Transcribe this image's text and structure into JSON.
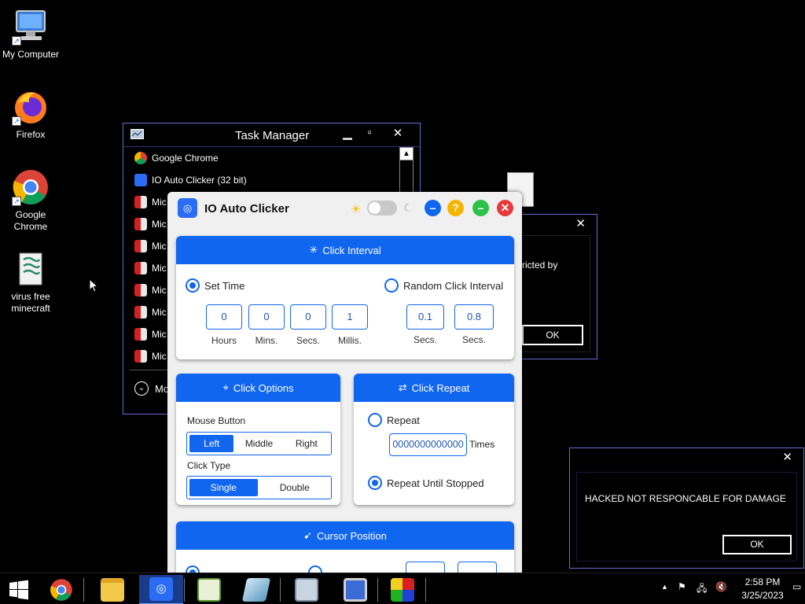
{
  "desktop": {
    "icons": [
      {
        "label": "My Computer",
        "icon": "computer-icon"
      },
      {
        "label": "Firefox",
        "icon": "firefox-icon"
      },
      {
        "label": "Google Chrome",
        "icon": "chrome-icon"
      },
      {
        "label": "virus free minecraft",
        "icon": "script-file-icon"
      }
    ]
  },
  "task_manager": {
    "title": "Task Manager",
    "processes": [
      {
        "name": "Google Chrome",
        "icon": "chrome-icon"
      },
      {
        "name": "IO Auto Clicker (32 bit)",
        "icon": "autoclicker-icon"
      },
      {
        "name": "Mic",
        "icon": "microsoft-app-icon"
      },
      {
        "name": "Mic",
        "icon": "microsoft-app-icon"
      },
      {
        "name": "Mic",
        "icon": "microsoft-app-icon"
      },
      {
        "name": "Mic",
        "icon": "microsoft-app-icon"
      },
      {
        "name": "Mic",
        "icon": "microsoft-app-icon"
      },
      {
        "name": "Mic",
        "icon": "microsoft-app-icon"
      },
      {
        "name": "Mic",
        "icon": "microsoft-app-icon"
      },
      {
        "name": "Mic",
        "icon": "microsoft-app-icon"
      }
    ],
    "more_details": "Mo"
  },
  "restricted_dialog": {
    "message": "ricted by",
    "ok": "OK"
  },
  "hacked_dialog": {
    "message": "HACKED NOT RESPONCABLE FOR DAMAGE",
    "ok": "OK"
  },
  "clicker": {
    "title": "IO Auto Clicker",
    "accent": "#1166f0",
    "click_interval": {
      "header": "Click Interval",
      "set_time_label": "Set Time",
      "random_label": "Random Click Interval",
      "hours": "0",
      "hours_label": "Hours",
      "mins": "0",
      "mins_label": "Mins.",
      "secs": "0",
      "secs_label": "Secs.",
      "millis": "1",
      "millis_label": "Millis.",
      "rand_min": "0.1",
      "rand_min_label": "Secs.",
      "rand_max": "0.8",
      "rand_max_label": "Secs."
    },
    "click_options": {
      "header": "Click Options",
      "mouse_button_label": "Mouse Button",
      "mouse_buttons": [
        "Left",
        "Middle",
        "Right"
      ],
      "mouse_selected": "Left",
      "click_type_label": "Click Type",
      "click_types": [
        "Single",
        "Double"
      ],
      "click_type_selected": "Single"
    },
    "click_repeat": {
      "header": "Click Repeat",
      "repeat_label": "Repeat",
      "repeat_value": "0000000000000",
      "times_label": "Times",
      "until_stopped_label": "Repeat Until Stopped"
    },
    "cursor_position": {
      "header": "Cursor Position"
    }
  },
  "taskbar": {
    "items": [
      "start-icon",
      "chrome-icon",
      "file-explorer-icon",
      "autoclicker-icon",
      "notepad-plus-icon",
      "app-icon",
      "task-manager-icon",
      "network-icon",
      "paint-icon"
    ],
    "time": "2:58 PM",
    "date": "3/25/2023"
  }
}
